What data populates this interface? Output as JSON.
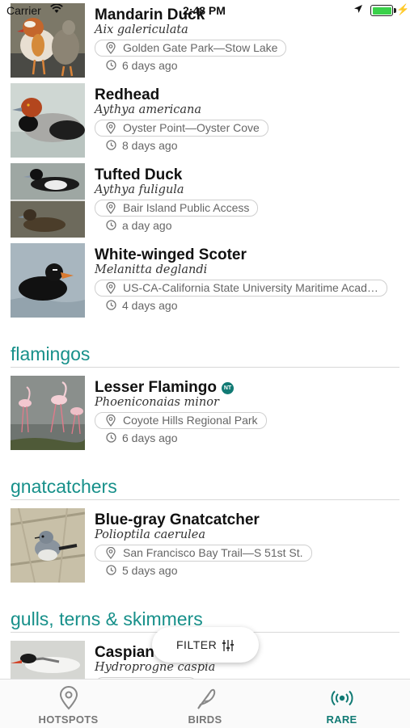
{
  "status_bar": {
    "carrier": "Carrier",
    "time": "2:48 PM"
  },
  "entries": [
    {
      "name": "Mandarin Duck",
      "scientific": "Aix galericulata",
      "location": "Golden Gate Park—Stow Lake",
      "ago": "6 days ago"
    },
    {
      "name": "Redhead",
      "scientific": "Aythya americana",
      "location": "Oyster Point—Oyster Cove",
      "ago": "8 days ago"
    },
    {
      "name": "Tufted Duck",
      "scientific": "Aythya fuligula",
      "location": "Bair Island Public Access",
      "ago": "a day ago"
    },
    {
      "name": "White-winged Scoter",
      "scientific": "Melanitta deglandi",
      "location": "US-CA-California State University Maritime Acad…",
      "ago": "4 days ago"
    },
    {
      "name": "Lesser Flamingo",
      "badge": "NT",
      "scientific": "Phoeniconaias minor",
      "location": "Coyote Hills Regional Park",
      "ago": "6 days ago"
    },
    {
      "name": "Blue-gray Gnatcatcher",
      "scientific": "Polioptila caerulea",
      "location": "San Francisco Bay Trail—S 51st St.",
      "ago": "5 days ago"
    },
    {
      "name": "Caspian",
      "scientific": "Hydroprogne caspia"
    }
  ],
  "sections": [
    "flamingos",
    "gnatcatchers",
    "gulls, terns & skimmers"
  ],
  "filter_label": "FILTER",
  "tabs": [
    {
      "label": "HOTSPOTS",
      "icon": "map-pin-icon"
    },
    {
      "label": "BIRDS",
      "icon": "feather-icon"
    },
    {
      "label": "RARE",
      "icon": "broadcast-icon",
      "active": true
    }
  ],
  "colors": {
    "accent": "#117a74",
    "section_text": "#17908a",
    "battery": "#3ad14a"
  }
}
